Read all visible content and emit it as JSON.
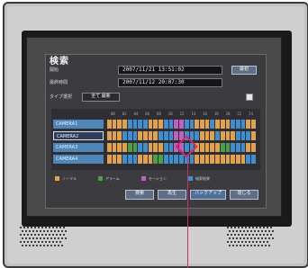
{
  "panel": {
    "title": "検索",
    "start_label": "開始",
    "start_value": "2007/11/21  13:51:02",
    "start_button": "最初",
    "end_label": "最終時間",
    "end_value": "2007/11/12  20:07:30",
    "record_type_label": "タイプ選択",
    "record_type_value": "全て 最新",
    "hours": [
      "00",
      "02",
      "04",
      "06",
      "08",
      "10",
      "12",
      "14",
      "16",
      "18",
      "20",
      "22",
      "24"
    ],
    "cameras": [
      {
        "name": "CAMERA1",
        "selected": false
      },
      {
        "name": "CAMERA2",
        "selected": true
      },
      {
        "name": "CAMERA3",
        "selected": false
      },
      {
        "name": "CAMERA4",
        "selected": false
      }
    ],
    "legend": [
      {
        "label": "ノーマル",
        "color": "#e2a24a"
      },
      {
        "label": "アラーム",
        "color": "#4aa04a"
      },
      {
        "label": "モーション",
        "color": "#c060c0"
      },
      {
        "label": "検索結果",
        "color": "#3f8fd0"
      }
    ],
    "buttons": {
      "search": "検索",
      "play": "再生",
      "backup": "バックアップ",
      "close": "閉じる"
    }
  },
  "colors": {
    "normal": "#e2a24a",
    "alarm": "#4aa04a",
    "motion": "#c060c0",
    "empty": "#3f8fd0",
    "pointer": "#d22a6a"
  }
}
